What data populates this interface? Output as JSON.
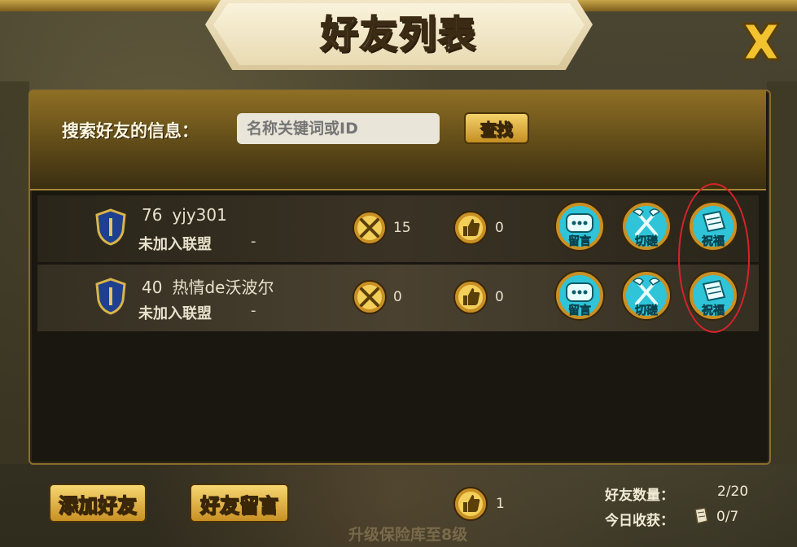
{
  "window": {
    "title": "好友列表"
  },
  "search": {
    "label": "搜索好友的信息：",
    "placeholder": "名称关键词或ID",
    "button": "查找"
  },
  "friends": [
    {
      "level": "76",
      "name": "yjy301",
      "alliance": "未加入联盟",
      "alliance_extra": "-",
      "battles": "15",
      "likes": "0",
      "actions": [
        "留言",
        "切磋",
        "祝福"
      ]
    },
    {
      "level": "40",
      "name": "热情de沃波尔",
      "alliance": "未加入联盟",
      "alliance_extra": "-",
      "battles": "0",
      "likes": "0",
      "actions": [
        "留言",
        "切磋",
        "祝福"
      ]
    }
  ],
  "footer": {
    "add_friend": "添加好友",
    "friend_message": "好友留言",
    "likes_total": "1",
    "friend_count_label": "好友数量：",
    "friend_count": "2/20",
    "today_label": "今日收获：",
    "today_value": "0/7",
    "ghost_text": "升级保险库至8级"
  },
  "colors": {
    "accent_gold": "#f5d36a",
    "highlight_red": "#d8232a",
    "action_teal": "#2fc4d8"
  },
  "icons": [
    "close-icon",
    "shield-icon",
    "crossed-swords-icon",
    "thumbs-up-icon",
    "chat-icon",
    "axes-icon",
    "scroll-icon"
  ]
}
